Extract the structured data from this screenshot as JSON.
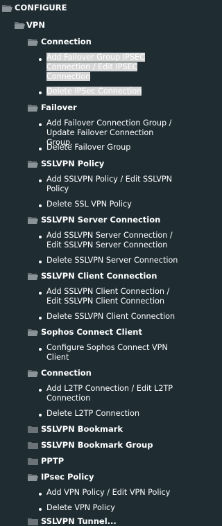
{
  "tree": {
    "root_label": "CONFIGURE",
    "vpn_label": "VPN",
    "connection_label": "Connection",
    "connection_items": [
      "Add Failover Group IPSEC Connection / Edit IPSEC Connection",
      "Delete IPSec Connection"
    ],
    "failover_label": "Failover",
    "failover_items": [
      "Add Failover Connection Group / Update Failover Connection Group.",
      "Delete Failover Group"
    ],
    "sslvpn_policy_label": "SSLVPN Policy",
    "sslvpn_policy_items": [
      "Add SSLVPN Policy / Edit SSLVPN Policy",
      "Delete SSL VPN Policy"
    ],
    "sslvpn_server_label": "SSLVPN Server Connection",
    "sslvpn_server_items": [
      "Add SSLVPN Server Connection / Edit SSLVPN Server Connection",
      "Delete SSLVPN Server Connection"
    ],
    "sslvpn_client_label": "SSLVPN Client Connection",
    "sslvpn_client_items": [
      "Add SSLVPN Client Connection / Edit SSLVPN Client Connection",
      "Delete SSLVPN Client Connection"
    ],
    "sophos_label": "Sophos Connect Client",
    "sophos_items": [
      "Configure Sophos Connect VPN Client"
    ],
    "l2tp_label": "Connection",
    "l2tp_items": [
      "Add L2TP Connection / Edit L2TP Connection",
      "Delete L2TP Connection"
    ],
    "bookmark_label": "SSLVPN Bookmark",
    "bookmark_group_label": "SSLVPN Bookmark Group",
    "pptp_label": "PPTP",
    "ipsec_policy_label": "IPsec Policy",
    "ipsec_policy_items": [
      "Add VPN Policy / Edit VPN Policy",
      "Delete VPN Policy"
    ],
    "cut_label": "SSLVPN Tunnel..."
  },
  "colors": {
    "background": "#1f2d33",
    "text": "#ffffff",
    "folder": "#6b7378",
    "highlight": "#d6d6d6"
  },
  "icons": {
    "folder": "folder-icon",
    "folder_open": "folder-open-icon"
  }
}
